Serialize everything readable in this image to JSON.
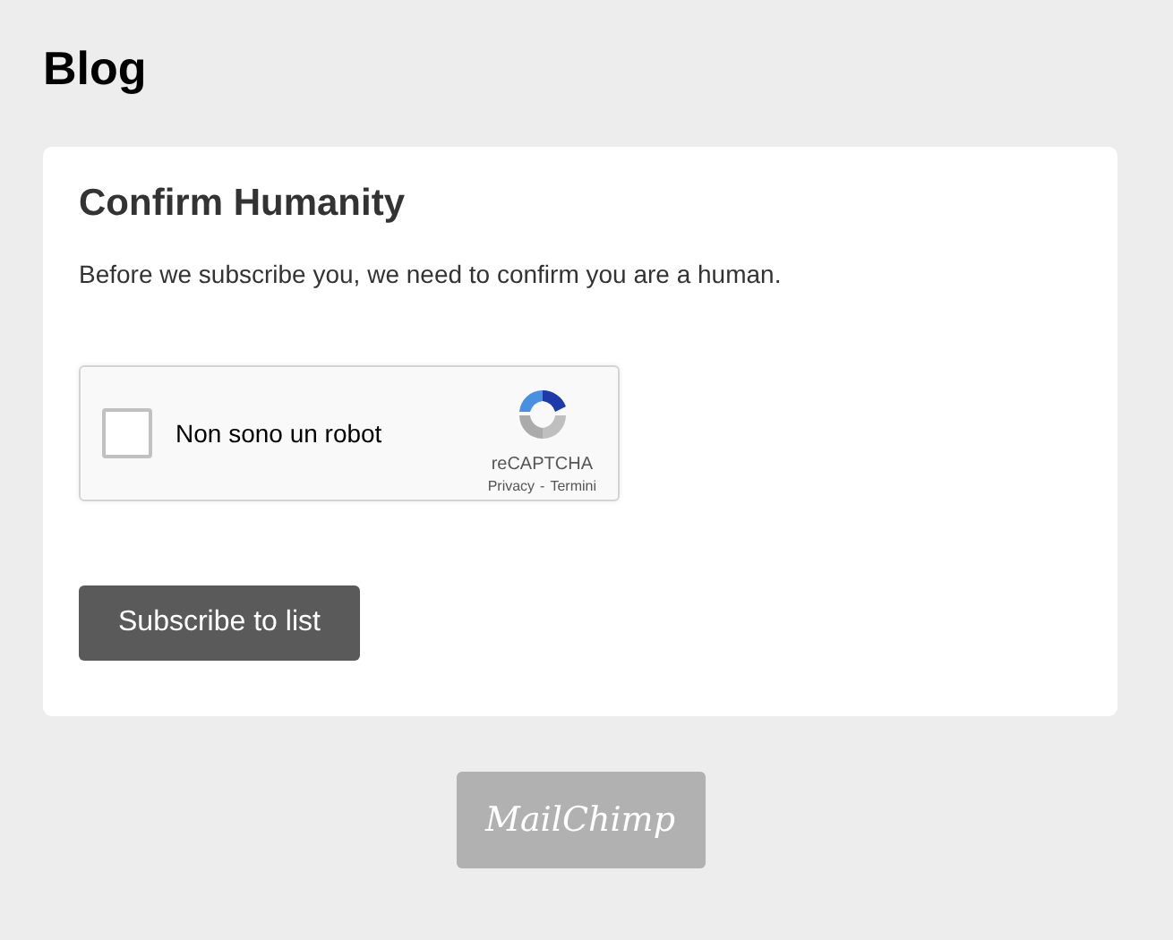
{
  "page_title": "Blog",
  "card": {
    "title": "Confirm Humanity",
    "message": "Before we subscribe you, we need to confirm you are a human.",
    "captcha": {
      "label": "Non sono un robot",
      "checked": false,
      "brand": "reCAPTCHA",
      "privacy_link": "Privacy",
      "separator": "-",
      "terms_link": "Termini"
    },
    "submit_button": "Subscribe to list"
  },
  "footer_logo": "MailChimp"
}
